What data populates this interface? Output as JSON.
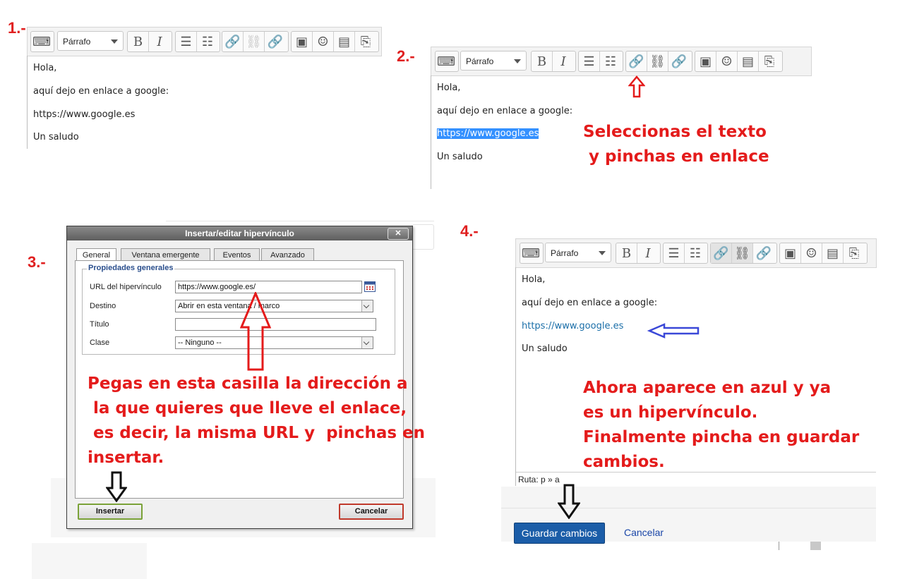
{
  "steps": {
    "s1": "1.-",
    "s2": "2.-",
    "s3": "3.-",
    "s4": "4.-"
  },
  "toolbar": {
    "format": "Párrafo",
    "bold": "B",
    "italic": "I"
  },
  "editor": {
    "line1": "Hola,",
    "line2": "aquí dejo en enlace a google:",
    "url": "https://www.google.es",
    "line4": "Un saludo"
  },
  "notes": {
    "step2": [
      "Seleccionas el texto",
      " y pinchas en enlace"
    ],
    "step3": [
      "Pegas en esta casilla la dirección a",
      " la que quieres que lleve el enlace,",
      " es decir, la misma URL y  pinchas en",
      "insertar."
    ],
    "step4": [
      "Ahora aparece en azul y ya",
      "es un hipervínculo.",
      "Finalmente pincha en guardar",
      "cambios."
    ]
  },
  "dialog": {
    "title": "Insertar/editar hipervínculo",
    "close": "✕",
    "tabs": [
      "General",
      "Ventana emergente",
      "Eventos",
      "Avanzado"
    ],
    "legend": "Propiedades generales",
    "fields": {
      "url_label": "URL del hipervínculo",
      "url_value": "https://www.google.es/",
      "target_label": "Destino",
      "target_value": "Abrir en esta ventana / marco",
      "title_label": "Título",
      "title_value": "",
      "class_label": "Clase",
      "class_value": "-- Ninguno --"
    },
    "insert": "Insertar",
    "cancel": "Cancelar"
  },
  "step4": {
    "path": "Ruta: p » a",
    "save": "Guardar cambios",
    "cancel": "Cancelar"
  },
  "colors": {
    "note_red": "#e41b1b",
    "link_blue": "#1a6ea8",
    "selection": "#3390ff",
    "save_blue": "#1b5da8"
  }
}
